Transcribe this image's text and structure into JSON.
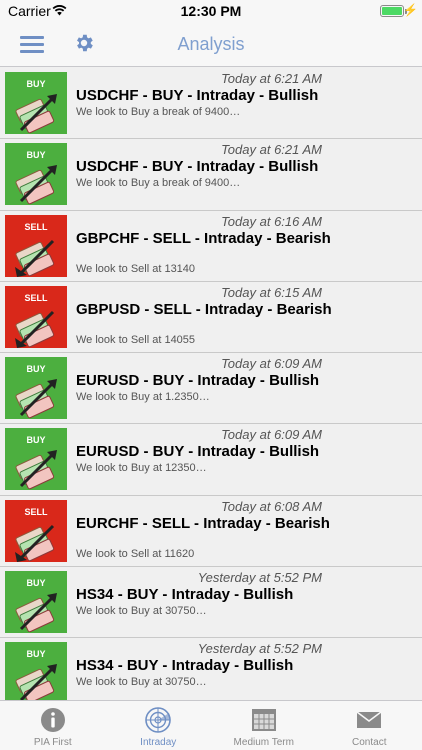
{
  "status_bar": {
    "carrier": "Carrier",
    "time": "12:30 PM",
    "battery_level": 1.0
  },
  "nav": {
    "title": "Analysis",
    "menu_icon": "hamburger-menu-icon",
    "settings_icon": "gear-icon"
  },
  "colors": {
    "buy": "#4caf3f",
    "sell": "#d9281a",
    "accent": "#6f8fc4"
  },
  "items": [
    {
      "tag": "BUY",
      "date": "Today at 6:21 AM",
      "title": "USDCHF - BUY - Intraday - Bullish",
      "summary": "We look to Buy a break of 9400…"
    },
    {
      "tag": "BUY",
      "date": "Today at 6:21 AM",
      "title": "USDCHF - BUY - Intraday - Bullish",
      "summary": "We look to Buy a break of 9400…"
    },
    {
      "tag": "SELL",
      "date": "Today at 6:16 AM",
      "title": "GBPCHF - SELL - Intraday - Bearish",
      "summary": "We look to Sell at 13140"
    },
    {
      "tag": "SELL",
      "date": "Today at 6:15 AM",
      "title": "GBPUSD - SELL - Intraday - Bearish",
      "summary": "We look to Sell at 14055"
    },
    {
      "tag": "BUY",
      "date": "Today at 6:09 AM",
      "title": "EURUSD - BUY - Intraday - Bullish",
      "summary": "We look to Buy at 1.2350…"
    },
    {
      "tag": "BUY",
      "date": "Today at 6:09 AM",
      "title": "EURUSD - BUY - Intraday - Bullish",
      "summary": "We look to Buy at 12350…"
    },
    {
      "tag": "SELL",
      "date": "Today at 6:08 AM",
      "title": "EURCHF - SELL - Intraday - Bearish",
      "summary": "We look to Sell at 11620"
    },
    {
      "tag": "BUY",
      "date": "Yesterday at 5:52 PM",
      "title": "HS34 - BUY - Intraday - Bullish",
      "summary": "We look to Buy at 30750…"
    },
    {
      "tag": "BUY",
      "date": "Yesterday at 5:52 PM",
      "title": "HS34 - BUY - Intraday - Bullish",
      "summary": "We look to Buy at 30750…"
    }
  ],
  "tabs": [
    {
      "label": "PIA First",
      "icon": "info-icon",
      "active": false
    },
    {
      "label": "Intraday",
      "icon": "radar-icon",
      "active": true
    },
    {
      "label": "Medium Term",
      "icon": "calendar-icon",
      "active": false
    },
    {
      "label": "Contact",
      "icon": "envelope-icon",
      "active": false
    }
  ]
}
